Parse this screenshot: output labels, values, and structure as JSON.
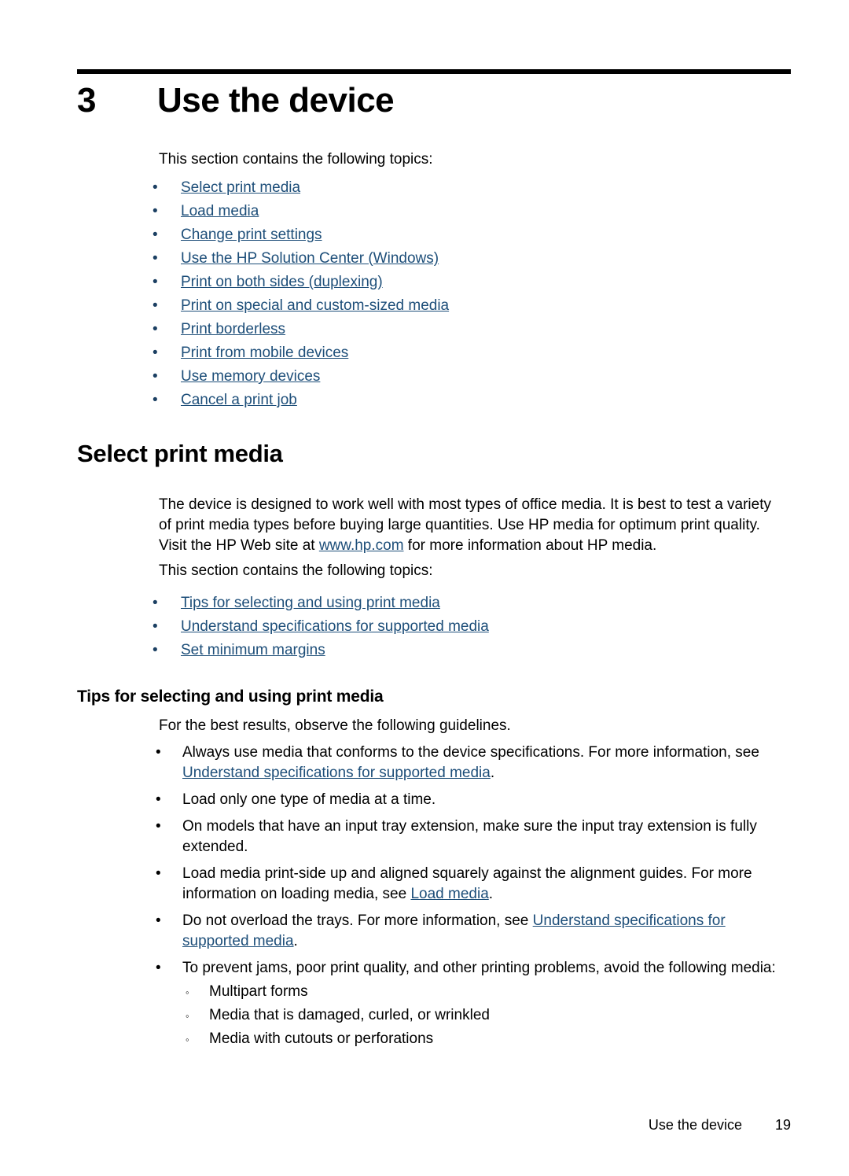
{
  "chapter": {
    "number": "3",
    "title": "Use the device"
  },
  "intro": {
    "topics_lead": "This section contains the following topics:",
    "bullet_glyph": "•",
    "links": [
      "Select print media",
      "Load media",
      "Change print settings",
      "Use the HP Solution Center (Windows)",
      "Print on both sides (duplexing)",
      "Print on special and custom-sized media",
      "Print borderless",
      "Print from mobile devices",
      "Use memory devices",
      "Cancel a print job"
    ]
  },
  "select_print_media": {
    "heading": "Select print media",
    "paragraph_part1": "The device is designed to work well with most types of office media. It is best to test a variety of print media types before buying large quantities. Use HP media for optimum print quality. Visit the HP Web site at ",
    "paragraph_link": "www.hp.com",
    "paragraph_part2": " for more information about HP media.",
    "topics_lead": "This section contains the following topics:",
    "links": [
      "Tips for selecting and using print media",
      "Understand specifications for supported media",
      "Set minimum margins"
    ]
  },
  "tips": {
    "heading": "Tips for selecting and using print media",
    "lead": "For the best results, observe the following guidelines.",
    "bullet_glyph": "•",
    "subbullet_glyph": "◦",
    "items": [
      {
        "part1": "Always use media that conforms to the device specifications. For more information, see ",
        "link": "Understand specifications for supported media",
        "part2": "."
      },
      {
        "part1": "Load only one type of media at a time.",
        "link": "",
        "part2": ""
      },
      {
        "part1": "On models that have an input tray extension, make sure the input tray extension is fully extended.",
        "link": "",
        "part2": ""
      },
      {
        "part1": "Load media print-side up and aligned squarely against the alignment guides. For more information on loading media, see ",
        "link": "Load media",
        "part2": "."
      },
      {
        "part1": "Do not overload the trays. For more information, see ",
        "link": "Understand specifications for supported media",
        "part2": "."
      },
      {
        "part1": "To prevent jams, poor print quality, and other printing problems, avoid the following media:",
        "link": "",
        "part2": ""
      }
    ],
    "avoid_media": [
      "Multipart forms",
      "Media that is damaged, curled, or wrinkled",
      "Media with cutouts or perforations"
    ]
  },
  "footer": {
    "label": "Use the device",
    "page": "19"
  },
  "colors": {
    "link": "#1d4e79",
    "text": "#000000",
    "rule": "#000000"
  }
}
